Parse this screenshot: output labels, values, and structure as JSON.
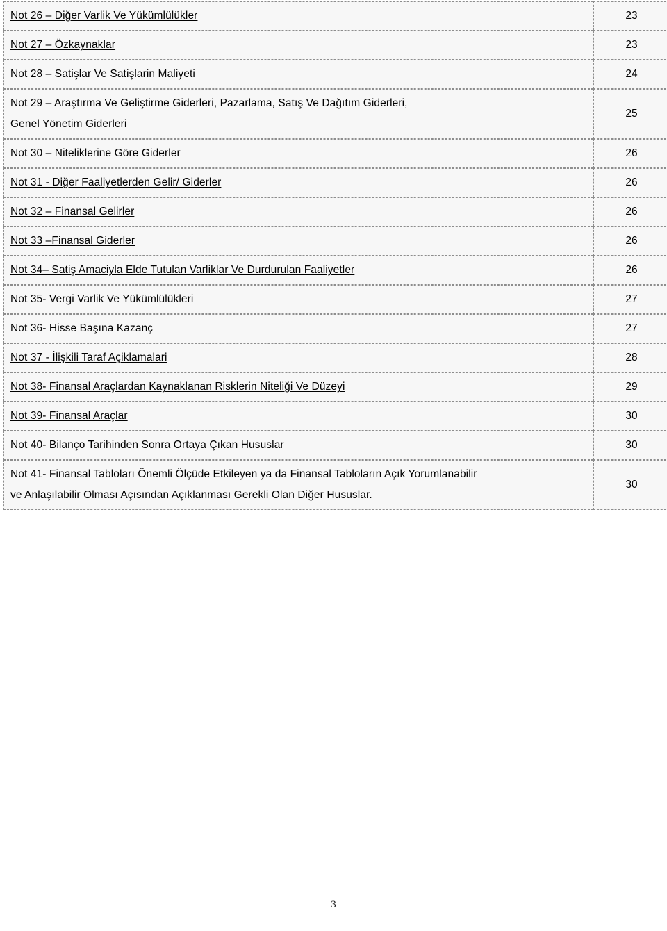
{
  "document": {
    "type": "table-of-contents",
    "language": "tr",
    "footer_page_number": "3"
  },
  "toc": {
    "rows": [
      {
        "title_lines": [
          "Not 26 – Diğer Varlik Ve Yükümlülükler"
        ],
        "page": "23"
      },
      {
        "title_lines": [
          "Not 27 – Özkaynaklar"
        ],
        "page": "23"
      },
      {
        "title_lines": [
          "Not 28 – Satişlar Ve Satişlarin Maliyeti"
        ],
        "page": "24"
      },
      {
        "title_lines": [
          "Not 29 – Araştırma Ve Geliştirme Giderleri, Pazarlama, Satış Ve Dağıtım Giderleri,",
          "Genel Yönetim Giderleri"
        ],
        "page": "25"
      },
      {
        "title_lines": [
          "Not 30 – Niteliklerine Göre Giderler"
        ],
        "page": "26"
      },
      {
        "title_lines": [
          "Not 31 - Diğer Faaliyetlerden Gelir/ Giderler"
        ],
        "page": "26"
      },
      {
        "title_lines": [
          "Not 32 – Finansal Gelirler"
        ],
        "page": "26"
      },
      {
        "title_lines": [
          "Not 33 –Finansal Giderler"
        ],
        "page": "26"
      },
      {
        "title_lines": [
          "Not 34– Satiş Amaciyla Elde Tutulan Varliklar Ve Durdurulan Faaliyetler"
        ],
        "page": "26"
      },
      {
        "title_lines": [
          "Not 35- Vergi Varlik Ve Yükümlülükleri"
        ],
        "page": "27"
      },
      {
        "title_lines": [
          "Not 36- Hisse Başına Kazanç"
        ],
        "page": "27"
      },
      {
        "title_lines": [
          "Not 37 - İlişkili Taraf Açiklamalari"
        ],
        "page": "28"
      },
      {
        "title_lines": [
          "Not 38- Finansal Araçlardan Kaynaklanan Risklerin Niteliği Ve Düzeyi"
        ],
        "page": "29"
      },
      {
        "title_lines": [
          "Not 39- Finansal Araçlar"
        ],
        "page": "30"
      },
      {
        "title_lines": [
          "Not 40- Bilanço Tarihinden Sonra Ortaya Çıkan Hususlar"
        ],
        "page": "30"
      },
      {
        "title_lines": [
          "Not 41- Finansal Tabloları Önemli Ölçüde Etkileyen ya da Finansal  Tabloların Açık Yorumlanabilir",
          "ve Anlaşılabilir Olması Açısından Açıklanması Gerekli Olan Diğer Hususlar."
        ],
        "page": "30"
      }
    ]
  }
}
